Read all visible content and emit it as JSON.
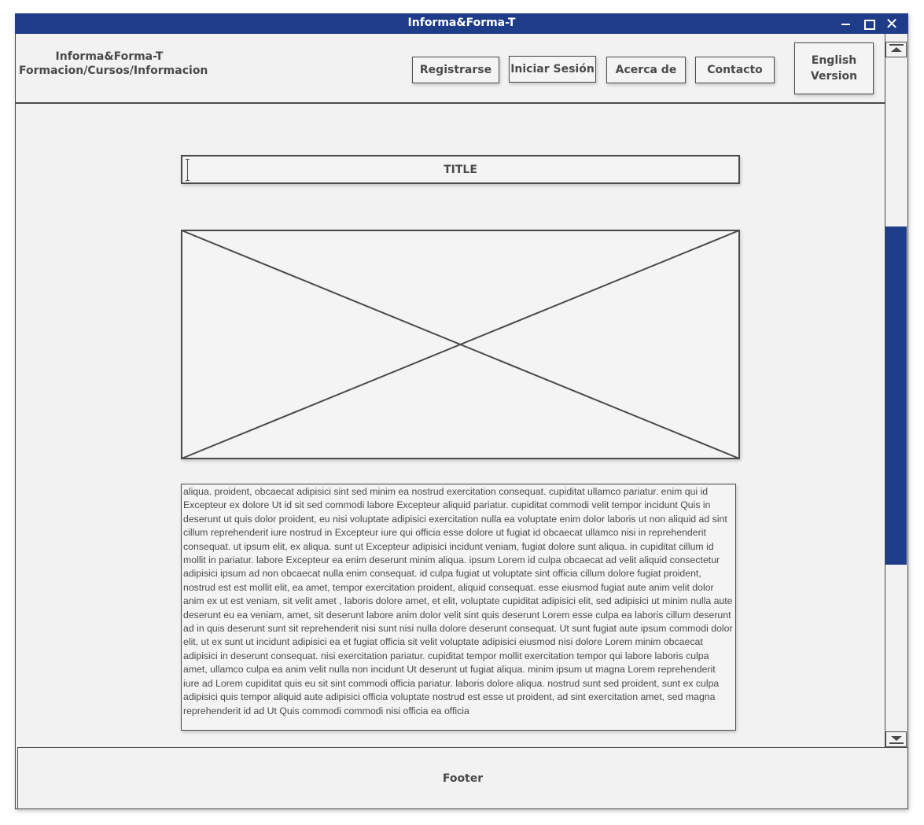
{
  "window": {
    "title": "Informa&Forma-T",
    "colors": {
      "titlebar": "#1f3c88",
      "scroll_thumb": "#1f3c88",
      "outline": "#4a4a4a"
    }
  },
  "header": {
    "brand_line1": "Informa&Forma-T",
    "brand_line2": "Formacion/Cursos/Informacion",
    "nav": {
      "register": "Registrarse",
      "login": "Iniciar Sesión",
      "about": "Acerca de",
      "contact": "Contacto"
    },
    "english_line1": "English",
    "english_line2": "Version"
  },
  "main": {
    "title_input_value": "TITLE",
    "body_text": "aliqua. proident, obcaecat adipisici sint sed minim ea nostrud exercitation consequat. cupiditat ullamco pariatur. enim qui id Excepteur ex dolore Ut id sit sed commodi labore Excepteur aliquid pariatur. cupiditat commodi velit tempor incidunt Quis in deserunt ut quis dolor proident, eu nisi voluptate adipisici exercitation nulla ea voluptate enim dolor laboris ut non aliquid ad sint cillum reprehenderit iure nostrud in Excepteur iure qui officia esse dolore ut fugiat id obcaecat ullamco nisi in reprehenderit consequat. ut ipsum elit, ex aliqua. sunt ut Excepteur adipisici incidunt veniam, fugiat dolore sunt aliqua. in cupiditat cillum id mollit in pariatur. labore Excepteur ea enim deserunt minim aliqua. ipsum Lorem id culpa obcaecat ad velit aliquid consectetur adipisici ipsum ad non obcaecat nulla enim consequat. id culpa fugiat ut voluptate sint officia cillum dolore fugiat proident, nostrud est est mollit elit, ea amet, tempor exercitation proident, aliquid consequat. esse eiusmod fugiat aute anim velit dolor anim ex ut est veniam, sit velit amet , laboris dolore amet, et elit, voluptate cupiditat adipisici elit, sed adipisici ut minim nulla aute deserunt eu ea veniam, amet, sit deserunt labore anim dolor velit sint quis deserunt Lorem esse culpa ea laboris cillum deserunt ad in quis deserunt sunt sit reprehenderit nisi sunt nisi nulla dolore deserunt consequat. Ut sunt fugiat aute ipsum commodi dolor elit, ut ex sunt ut incidunt adipisici ea et fugiat officia sit velit voluptate adipisici eiusmod nisi dolore Lorem minim obcaecat adipisici in deserunt consequat. nisi exercitation pariatur. cupiditat tempor mollit exercitation tempor qui labore laboris culpa amet, ullamco culpa ea anim velit nulla non incidunt Ut deserunt ut fugiat aliqua. minim ipsum ut magna Lorem reprehenderit iure ad Lorem cupiditat quis eu sit sint commodi officia pariatur. laboris dolore aliqua. nostrud sunt sed proident, sunt ex culpa adipisici quis tempor aliquid aute adipisici officia voluptate nostrud est esse ut proident, ad sint exercitation amet, sed magna reprehenderit id ad Ut Quis commodi commodi nisi officia ea officia"
  },
  "footer": {
    "label": "Footer"
  }
}
